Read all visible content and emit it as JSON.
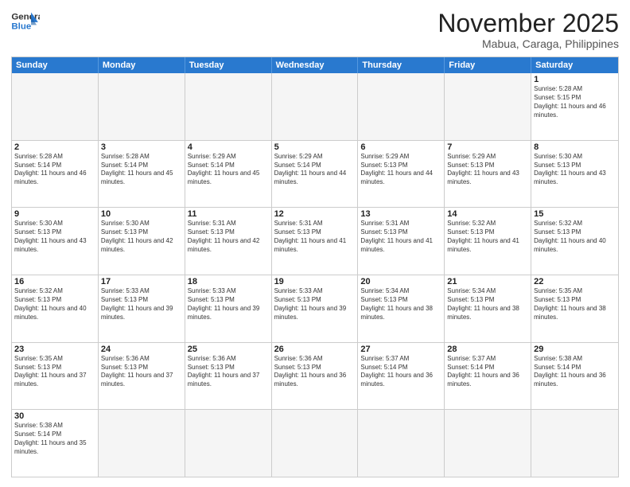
{
  "logo": {
    "line1": "General",
    "line2": "Blue"
  },
  "title": "November 2025",
  "location": "Mabua, Caraga, Philippines",
  "days_header": [
    "Sunday",
    "Monday",
    "Tuesday",
    "Wednesday",
    "Thursday",
    "Friday",
    "Saturday"
  ],
  "weeks": [
    [
      {
        "day": "",
        "empty": true
      },
      {
        "day": "",
        "empty": true
      },
      {
        "day": "",
        "empty": true
      },
      {
        "day": "",
        "empty": true
      },
      {
        "day": "",
        "empty": true
      },
      {
        "day": "",
        "empty": true
      },
      {
        "day": "1",
        "sunrise": "5:28 AM",
        "sunset": "5:15 PM",
        "daylight": "11 hours and 46 minutes."
      }
    ],
    [
      {
        "day": "2",
        "sunrise": "5:28 AM",
        "sunset": "5:14 PM",
        "daylight": "11 hours and 46 minutes."
      },
      {
        "day": "3",
        "sunrise": "5:28 AM",
        "sunset": "5:14 PM",
        "daylight": "11 hours and 45 minutes."
      },
      {
        "day": "4",
        "sunrise": "5:29 AM",
        "sunset": "5:14 PM",
        "daylight": "11 hours and 45 minutes."
      },
      {
        "day": "5",
        "sunrise": "5:29 AM",
        "sunset": "5:14 PM",
        "daylight": "11 hours and 44 minutes."
      },
      {
        "day": "6",
        "sunrise": "5:29 AM",
        "sunset": "5:13 PM",
        "daylight": "11 hours and 44 minutes."
      },
      {
        "day": "7",
        "sunrise": "5:29 AM",
        "sunset": "5:13 PM",
        "daylight": "11 hours and 43 minutes."
      },
      {
        "day": "8",
        "sunrise": "5:30 AM",
        "sunset": "5:13 PM",
        "daylight": "11 hours and 43 minutes."
      }
    ],
    [
      {
        "day": "9",
        "sunrise": "5:30 AM",
        "sunset": "5:13 PM",
        "daylight": "11 hours and 43 minutes."
      },
      {
        "day": "10",
        "sunrise": "5:30 AM",
        "sunset": "5:13 PM",
        "daylight": "11 hours and 42 minutes."
      },
      {
        "day": "11",
        "sunrise": "5:31 AM",
        "sunset": "5:13 PM",
        "daylight": "11 hours and 42 minutes."
      },
      {
        "day": "12",
        "sunrise": "5:31 AM",
        "sunset": "5:13 PM",
        "daylight": "11 hours and 41 minutes."
      },
      {
        "day": "13",
        "sunrise": "5:31 AM",
        "sunset": "5:13 PM",
        "daylight": "11 hours and 41 minutes."
      },
      {
        "day": "14",
        "sunrise": "5:32 AM",
        "sunset": "5:13 PM",
        "daylight": "11 hours and 41 minutes."
      },
      {
        "day": "15",
        "sunrise": "5:32 AM",
        "sunset": "5:13 PM",
        "daylight": "11 hours and 40 minutes."
      }
    ],
    [
      {
        "day": "16",
        "sunrise": "5:32 AM",
        "sunset": "5:13 PM",
        "daylight": "11 hours and 40 minutes."
      },
      {
        "day": "17",
        "sunrise": "5:33 AM",
        "sunset": "5:13 PM",
        "daylight": "11 hours and 39 minutes."
      },
      {
        "day": "18",
        "sunrise": "5:33 AM",
        "sunset": "5:13 PM",
        "daylight": "11 hours and 39 minutes."
      },
      {
        "day": "19",
        "sunrise": "5:33 AM",
        "sunset": "5:13 PM",
        "daylight": "11 hours and 39 minutes."
      },
      {
        "day": "20",
        "sunrise": "5:34 AM",
        "sunset": "5:13 PM",
        "daylight": "11 hours and 38 minutes."
      },
      {
        "day": "21",
        "sunrise": "5:34 AM",
        "sunset": "5:13 PM",
        "daylight": "11 hours and 38 minutes."
      },
      {
        "day": "22",
        "sunrise": "5:35 AM",
        "sunset": "5:13 PM",
        "daylight": "11 hours and 38 minutes."
      }
    ],
    [
      {
        "day": "23",
        "sunrise": "5:35 AM",
        "sunset": "5:13 PM",
        "daylight": "11 hours and 37 minutes."
      },
      {
        "day": "24",
        "sunrise": "5:36 AM",
        "sunset": "5:13 PM",
        "daylight": "11 hours and 37 minutes."
      },
      {
        "day": "25",
        "sunrise": "5:36 AM",
        "sunset": "5:13 PM",
        "daylight": "11 hours and 37 minutes."
      },
      {
        "day": "26",
        "sunrise": "5:36 AM",
        "sunset": "5:13 PM",
        "daylight": "11 hours and 36 minutes."
      },
      {
        "day": "27",
        "sunrise": "5:37 AM",
        "sunset": "5:14 PM",
        "daylight": "11 hours and 36 minutes."
      },
      {
        "day": "28",
        "sunrise": "5:37 AM",
        "sunset": "5:14 PM",
        "daylight": "11 hours and 36 minutes."
      },
      {
        "day": "29",
        "sunrise": "5:38 AM",
        "sunset": "5:14 PM",
        "daylight": "11 hours and 36 minutes."
      }
    ],
    [
      {
        "day": "30",
        "sunrise": "5:38 AM",
        "sunset": "5:14 PM",
        "daylight": "11 hours and 35 minutes."
      },
      {
        "day": "",
        "empty": true
      },
      {
        "day": "",
        "empty": true
      },
      {
        "day": "",
        "empty": true
      },
      {
        "day": "",
        "empty": true
      },
      {
        "day": "",
        "empty": true
      },
      {
        "day": "",
        "empty": true
      }
    ]
  ]
}
